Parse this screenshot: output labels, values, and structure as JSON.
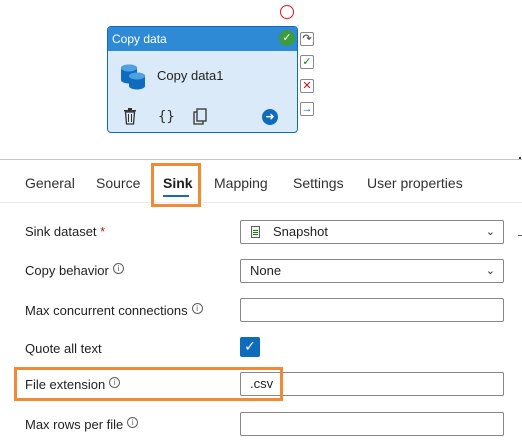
{
  "activity": {
    "header": "Copy data",
    "name": "Copy data1",
    "icons": [
      "database-icon",
      "delete-icon",
      "code-braces-icon",
      "copy-icon",
      "go-arrow-icon",
      "success-check-icon"
    ]
  },
  "side_connectors": [
    "skip-arrow-icon",
    "on-success-check-icon",
    "on-failure-x-icon",
    "on-completion-arrow-icon"
  ],
  "tabs": {
    "items": [
      "General",
      "Source",
      "Sink",
      "Mapping",
      "Settings",
      "User properties"
    ],
    "active": "Sink"
  },
  "form": {
    "sink_dataset": {
      "label": "Sink dataset",
      "required_mark": "*",
      "value": "Snapshot"
    },
    "copy_behavior": {
      "label": "Copy behavior",
      "value": "None"
    },
    "max_concurrent_connections": {
      "label": "Max concurrent connections",
      "value": ""
    },
    "quote_all_text": {
      "label": "Quote all text",
      "checked": true
    },
    "file_extension": {
      "label": "File extension",
      "value": ".csv"
    },
    "max_rows_per_file": {
      "label": "Max rows per file",
      "value": ""
    }
  },
  "colors": {
    "accent": "#0f6cbd",
    "highlight": "#f08a34",
    "success": "#3d9c3b",
    "error": "#e81123"
  }
}
